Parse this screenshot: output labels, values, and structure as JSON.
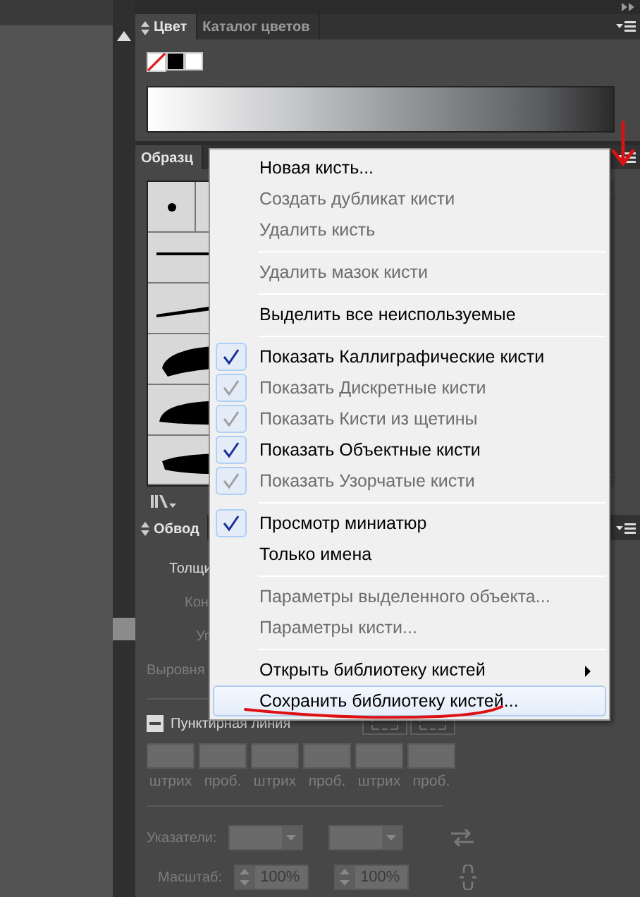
{
  "color_panel": {
    "tabs": [
      {
        "label": "Цвет",
        "selected": true
      },
      {
        "label": "Каталог цветов",
        "selected": false
      }
    ]
  },
  "brushes_panel": {
    "title": "Образц"
  },
  "stroke_panel": {
    "title": "Обвод",
    "rows": [
      {
        "label": "Толщи",
        "disabled": false
      },
      {
        "label": "Кон",
        "disabled": true
      },
      {
        "label": "Уг",
        "disabled": true
      },
      {
        "label": "Выровня",
        "disabled": true
      }
    ],
    "dashed_line": {
      "label": "Пунктирная линия",
      "checked": true
    },
    "dash_fields": [
      {
        "label": "штрих"
      },
      {
        "label": "проб."
      },
      {
        "label": "штрих"
      },
      {
        "label": "проб."
      },
      {
        "label": "штрих"
      },
      {
        "label": "проб."
      }
    ],
    "arrowheads": {
      "label": "Указатели:"
    },
    "scale": {
      "label": "Масштаб:",
      "values": [
        "100%",
        "100%"
      ]
    }
  },
  "menu": {
    "items": [
      {
        "kind": "item",
        "label": "Новая кисть...",
        "disabled": false,
        "checked": false,
        "selected": false
      },
      {
        "kind": "item",
        "label": "Создать дубликат кисти",
        "disabled": true,
        "checked": false,
        "selected": false
      },
      {
        "kind": "item",
        "label": "Удалить кисть",
        "disabled": true,
        "checked": false,
        "selected": false
      },
      {
        "kind": "separator"
      },
      {
        "kind": "item",
        "label": "Удалить мазок кисти",
        "disabled": true,
        "checked": false,
        "selected": false
      },
      {
        "kind": "separator"
      },
      {
        "kind": "item",
        "label": "Выделить все неиспользуемые",
        "disabled": false,
        "checked": false,
        "selected": false
      },
      {
        "kind": "separator"
      },
      {
        "kind": "item",
        "label": "Показать Каллиграфические кисти",
        "disabled": false,
        "checked": true,
        "selected": false
      },
      {
        "kind": "item",
        "label": "Показать Дискретные кисти",
        "disabled": true,
        "checked": true,
        "selected": false
      },
      {
        "kind": "item",
        "label": "Показать Кисти из щетины",
        "disabled": true,
        "checked": true,
        "selected": false
      },
      {
        "kind": "item",
        "label": "Показать Объектные кисти",
        "disabled": false,
        "checked": true,
        "selected": false
      },
      {
        "kind": "item",
        "label": "Показать Узорчатые кисти",
        "disabled": true,
        "checked": true,
        "selected": false
      },
      {
        "kind": "separator"
      },
      {
        "kind": "item",
        "label": "Просмотр миниатюр",
        "disabled": false,
        "checked": true,
        "selected": false
      },
      {
        "kind": "item",
        "label": "Только имена",
        "disabled": false,
        "checked": false,
        "selected": false
      },
      {
        "kind": "separator"
      },
      {
        "kind": "item",
        "label": "Параметры выделенного объекта...",
        "disabled": true,
        "checked": false,
        "selected": false
      },
      {
        "kind": "item",
        "label": "Параметры кисти...",
        "disabled": true,
        "checked": false,
        "selected": false
      },
      {
        "kind": "separator"
      },
      {
        "kind": "submenu",
        "label": "Открыть библиотеку кистей",
        "disabled": false,
        "checked": false,
        "selected": false
      },
      {
        "kind": "item",
        "label": "Сохранить библиотеку кистей...",
        "disabled": false,
        "checked": false,
        "selected": true
      }
    ]
  }
}
